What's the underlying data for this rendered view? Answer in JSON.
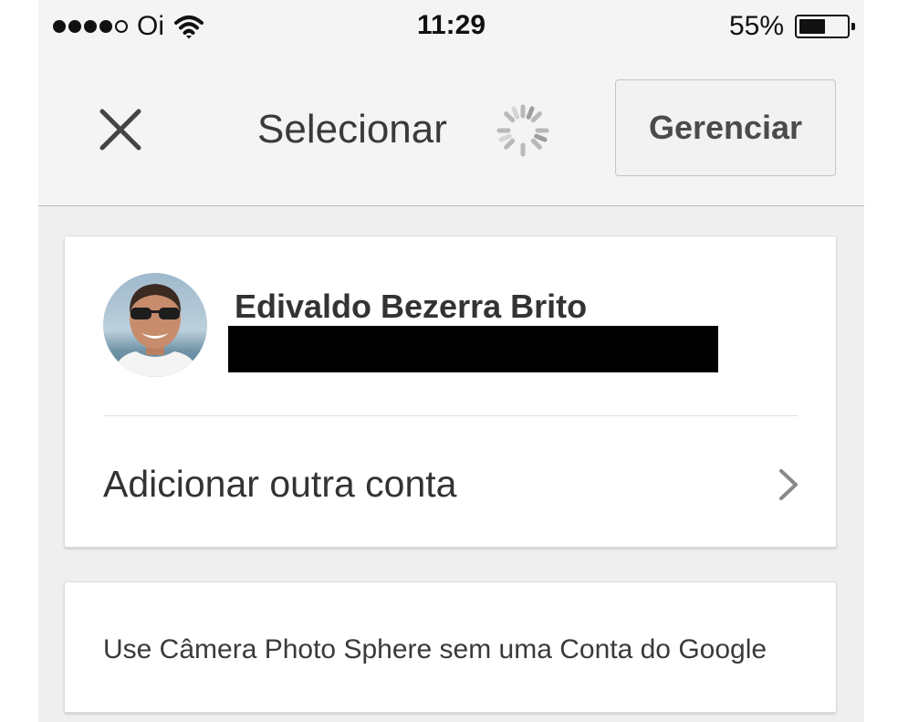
{
  "status_bar": {
    "carrier": "Oi",
    "time": "11:29",
    "battery_percent": "55%",
    "battery_level": 0.55,
    "signal_bars_filled": 4,
    "signal_bars_total": 5
  },
  "nav_bar": {
    "close_icon": "close-icon",
    "title": "Selecionar",
    "loading_icon": "spinner-icon",
    "manage_label": "Gerenciar"
  },
  "accounts": [
    {
      "name": "Edivaldo Bezerra Brito",
      "avatar_icon": "avatar"
    }
  ],
  "add_account": {
    "label": "Adicionar outra conta",
    "icon": "chevron-right-icon"
  },
  "no_account_option": {
    "label": "Use Câmera Photo Sphere sem uma Conta do Google"
  },
  "colors": {
    "background": "#efefef",
    "bar": "#f4f4f4",
    "card": "#ffffff",
    "text": "#333333",
    "redaction": "#000000"
  }
}
